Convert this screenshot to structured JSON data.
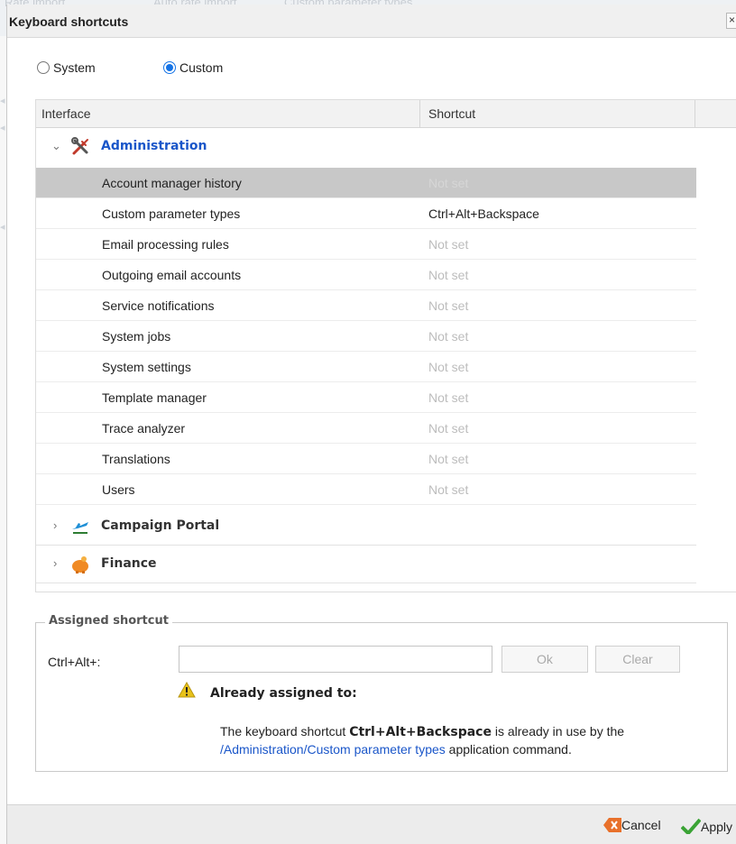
{
  "background": {
    "tab_1": "Rate import",
    "tab_2": "Auto rate import",
    "tab_3": "Custom parameter types"
  },
  "dialog": {
    "title": "Keyboard shortcuts",
    "close_glyph": "×"
  },
  "mode": {
    "options": [
      {
        "label": "System",
        "selected": false
      },
      {
        "label": "Custom",
        "selected": true
      }
    ]
  },
  "grid": {
    "columns": [
      "Interface",
      "Shortcut"
    ],
    "groups": [
      {
        "label": "Administration",
        "icon": "tools-icon",
        "expanded": true,
        "items": [
          {
            "name": "Account manager history",
            "shortcut": "Not set",
            "selected": true
          },
          {
            "name": "Custom parameter types",
            "shortcut": "Ctrl+Alt+Backspace"
          },
          {
            "name": "Email processing rules",
            "shortcut": "Not set"
          },
          {
            "name": "Outgoing email accounts",
            "shortcut": "Not set"
          },
          {
            "name": "Service notifications",
            "shortcut": "Not set"
          },
          {
            "name": "System jobs",
            "shortcut": "Not set"
          },
          {
            "name": "System settings",
            "shortcut": "Not set"
          },
          {
            "name": "Template manager",
            "shortcut": "Not set"
          },
          {
            "name": "Trace analyzer",
            "shortcut": "Not set"
          },
          {
            "name": "Translations",
            "shortcut": "Not set"
          },
          {
            "name": "Users",
            "shortcut": "Not set"
          }
        ]
      },
      {
        "label": "Campaign Portal",
        "icon": "plane-icon",
        "expanded": false
      },
      {
        "label": "Finance",
        "icon": "piggy-bank-icon",
        "expanded": false
      }
    ]
  },
  "assigned": {
    "legend": "Assigned shortcut",
    "prefix": "Ctrl+Alt+:",
    "input_value": "",
    "ok_label": "Ok",
    "clear_label": "Clear",
    "warning_title": "Already assigned to:",
    "message_pre": "The keyboard shortcut ",
    "message_shortcut": "Ctrl+Alt+Backspace",
    "message_mid": " is already in use by the",
    "message_link": "/Administration/Custom parameter types",
    "message_post": " application command."
  },
  "footer": {
    "cancel_label": "Cancel",
    "apply_label": "Apply"
  },
  "colors": {
    "link": "#1a56c9",
    "radio_accent": "#1473e6",
    "selected_row": "#c8c8c8",
    "cancel_icon": "#e8702a",
    "apply_icon": "#3aa335",
    "warning_icon": "#e8c21a"
  }
}
